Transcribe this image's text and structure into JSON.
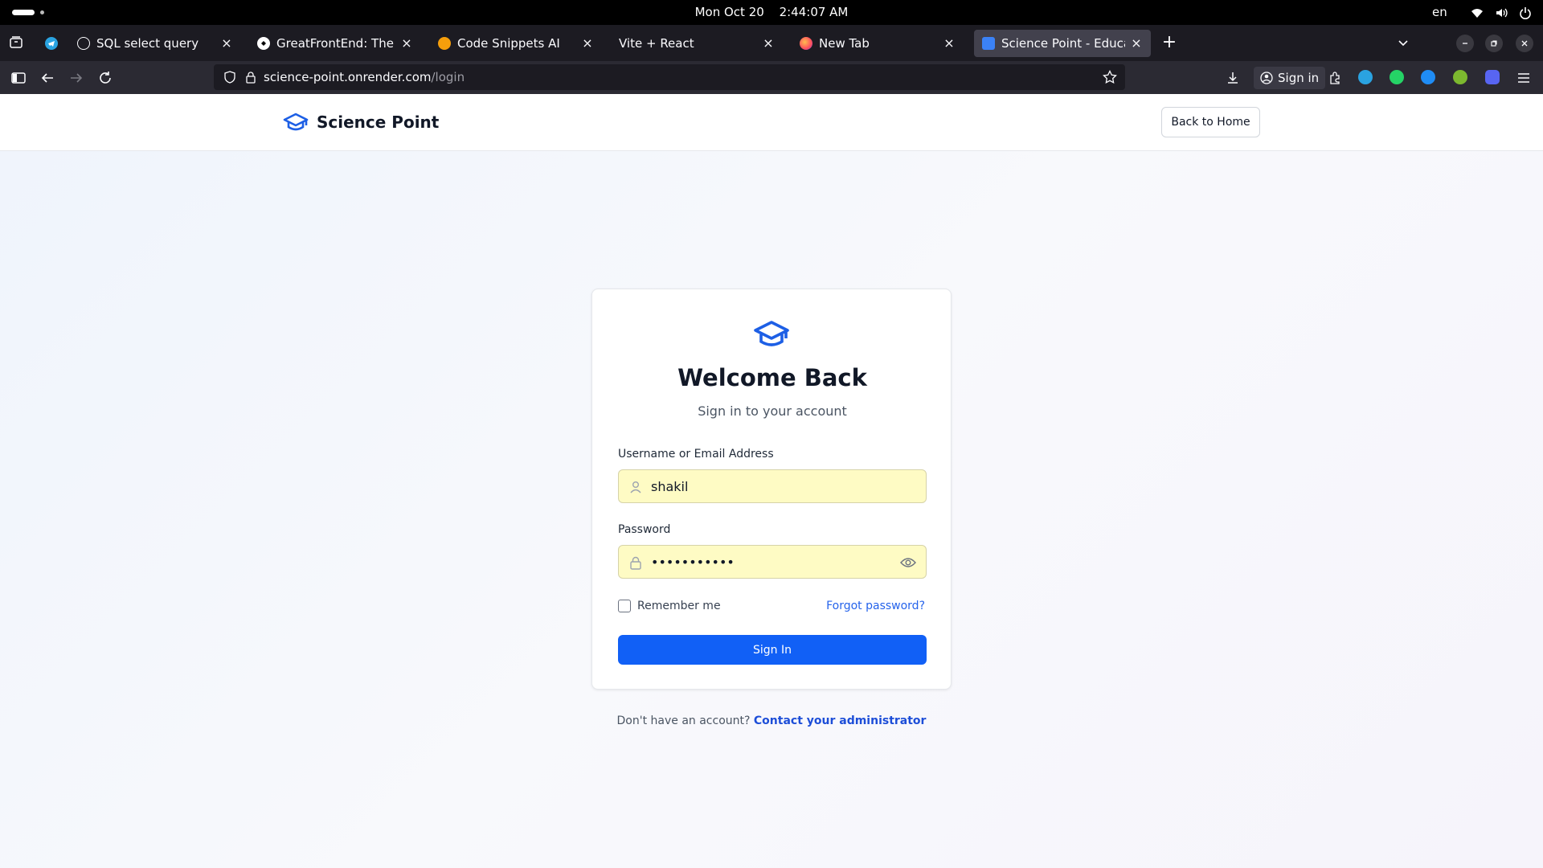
{
  "os": {
    "date": "Mon Oct 20",
    "time": "2:44:07 AM",
    "lang": "en"
  },
  "browser": {
    "tabs": [
      {
        "title": "",
        "icon": "telegram-icon",
        "active": false
      },
      {
        "title": "SQL select query",
        "icon": "openai-icon",
        "active": false
      },
      {
        "title": "GreatFrontEnd: The great",
        "icon": "greatfrontend-icon",
        "active": false
      },
      {
        "title": "Code Snippets AI",
        "icon": "codesnippets-icon",
        "active": false
      },
      {
        "title": "Vite + React",
        "icon": "",
        "active": false
      },
      {
        "title": "New Tab",
        "icon": "firefox-icon",
        "active": false
      },
      {
        "title": "Science Point - Education",
        "icon": "science-point-icon",
        "active": true
      }
    ],
    "url_host": "science-point.onrender.com",
    "url_path": "/login",
    "signin_label": "Sign in"
  },
  "site": {
    "brand_name": "Science Point",
    "back_home_label": "Back to Home",
    "accent_color": "#1160f6"
  },
  "login": {
    "title": "Welcome Back",
    "subtitle": "Sign in to your account",
    "username_label": "Username or Email Address",
    "username_value": "shakil",
    "password_label": "Password",
    "password_value": "•••••••••••",
    "remember_label": "Remember me",
    "remember_checked": false,
    "forgot_label": "Forgot password?",
    "submit_label": "Sign In",
    "footer_text": "Don't have an account?",
    "footer_link": "Contact your administrator"
  }
}
